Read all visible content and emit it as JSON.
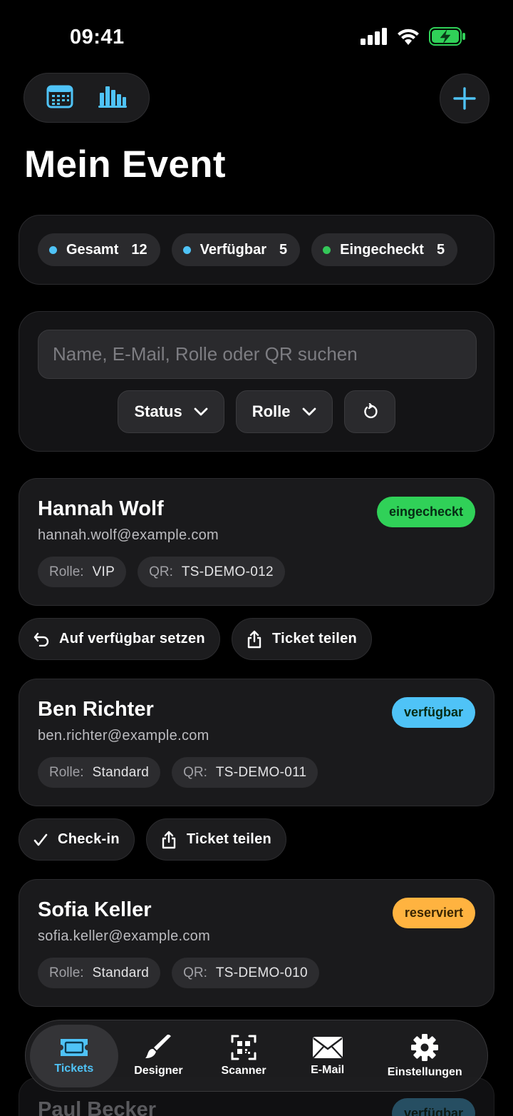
{
  "status_bar": {
    "time": "09:41"
  },
  "header": {
    "title": "Mein Event"
  },
  "stats": [
    {
      "label": "Gesamt",
      "value": "12",
      "color": "#4fc3f7"
    },
    {
      "label": "Verfügbar",
      "value": "5",
      "color": "#4fc3f7"
    },
    {
      "label": "Eingecheckt",
      "value": "5",
      "color": "#34c759"
    }
  ],
  "search": {
    "placeholder": "Name, E-Mail, Rolle oder QR suchen",
    "status_filter": "Status",
    "role_filter": "Rolle"
  },
  "tickets": [
    {
      "name": "Hannah Wolf",
      "email": "hannah.wolf@example.com",
      "status": "eingecheckt",
      "status_color": "#30d158",
      "role_label": "Rolle:",
      "role": "VIP",
      "qr_label": "QR:",
      "qr": "TS-DEMO-012",
      "primary_action": "Auf verfügbar setzen",
      "share_action": "Ticket teilen"
    },
    {
      "name": "Ben Richter",
      "email": "ben.richter@example.com",
      "status": "verfügbar",
      "status_color": "#4fc3f7",
      "role_label": "Rolle:",
      "role": "Standard",
      "qr_label": "QR:",
      "qr": "TS-DEMO-011",
      "primary_action": "Check-in",
      "share_action": "Ticket teilen"
    },
    {
      "name": "Sofia Keller",
      "email": "sofia.keller@example.com",
      "status": "reserviert",
      "status_color": "#ffb340",
      "role_label": "Rolle:",
      "role": "Standard",
      "qr_label": "QR:",
      "qr": "TS-DEMO-010"
    },
    {
      "name": "Paul Becker",
      "status": "verfügbar",
      "status_color": "#4fc3f7"
    }
  ],
  "nav": [
    {
      "label": "Tickets",
      "icon": "ticket-icon",
      "active": true
    },
    {
      "label": "Designer",
      "icon": "brush-icon"
    },
    {
      "label": "Scanner",
      "icon": "qr-scanner-icon"
    },
    {
      "label": "E-Mail",
      "icon": "envelope-icon"
    },
    {
      "label": "Einstellungen",
      "icon": "gear-icon"
    }
  ],
  "colors": {
    "accent": "#4fc3f7",
    "success": "#30d158",
    "warning": "#ffb340"
  }
}
